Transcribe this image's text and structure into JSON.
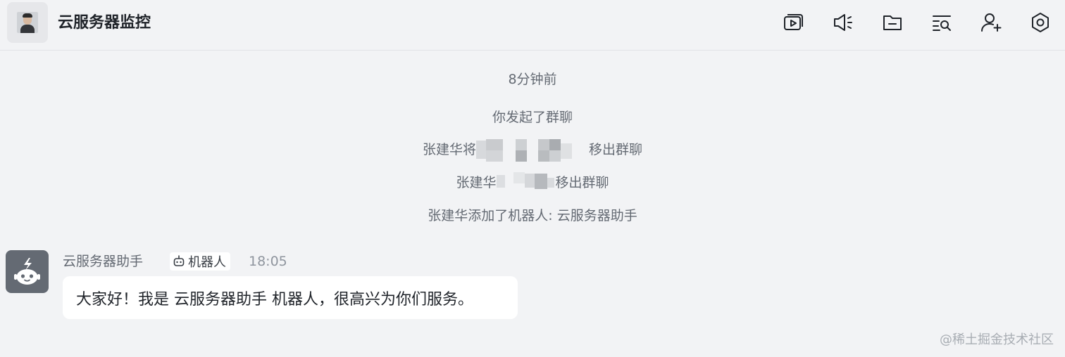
{
  "header": {
    "title": "云服务器监控",
    "avatar_icon": "user-photo",
    "toolbar_icons": [
      "video-meeting-icon",
      "announcement-icon",
      "folder-icon",
      "search-history-icon",
      "add-member-icon",
      "settings-icon"
    ]
  },
  "system_messages": {
    "time": "8分钟前",
    "started": "你发起了群聊",
    "removed_1_prefix": "张建华将",
    "removed_1_suffix": "移出群聊",
    "removed_2_prefix": "张建华",
    "removed_2_suffix": "移出群聊",
    "added_bot": "张建华添加了机器人: 云服务器助手"
  },
  "message": {
    "sender": "云服务器助手",
    "tag_label": "机器人",
    "time": "18:05",
    "text": "大家好！我是 云服务器助手 机器人，很高兴为你们服务。"
  },
  "watermark": "@稀土掘金技术社区",
  "colors": {
    "background": "#f2f3f5",
    "bubble": "#ffffff",
    "bot_avatar": "#646a73",
    "secondary_text": "#646a73"
  }
}
